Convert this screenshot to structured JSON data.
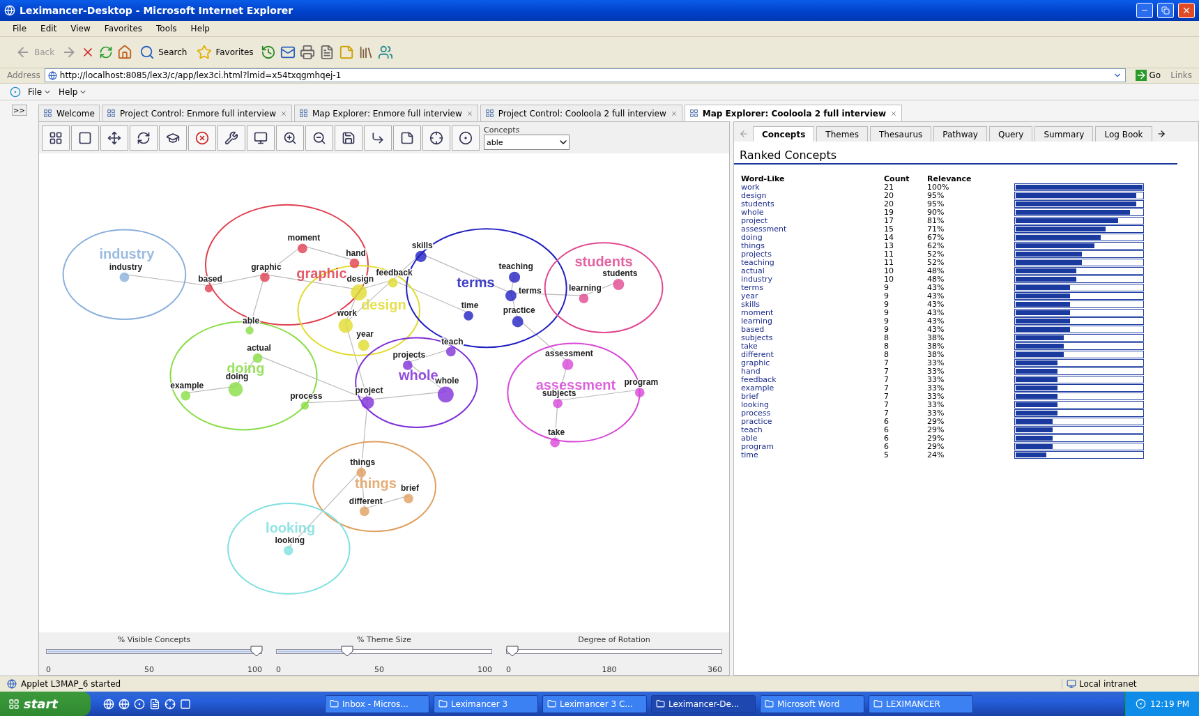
{
  "window": {
    "title": "Leximancer-Desktop - Microsoft Internet Explorer"
  },
  "menu_bar": [
    "File",
    "Edit",
    "View",
    "Favorites",
    "Tools",
    "Help"
  ],
  "toolbar_buttons": [
    {
      "label": "Back",
      "disabled": true
    },
    {
      "label": "Search",
      "disabled": false
    },
    {
      "label": "Favorites",
      "disabled": false
    }
  ],
  "address_bar": {
    "label": "Address",
    "value": "http://localhost:8085/lex3/c/app/lex3ci.html?lmid=x54txqgmhqej-1",
    "go": "Go",
    "links": "Links"
  },
  "app_menu": [
    "File",
    "Help"
  ],
  "side_toggle": ">>",
  "document_tabs": [
    {
      "label": "Welcome",
      "selected": false
    },
    {
      "label": "Project Control: Enmore full interview",
      "selected": false
    },
    {
      "label": "Map Explorer: Enmore full interview",
      "selected": false
    },
    {
      "label": "Project Control: Cooloola 2 full interview",
      "selected": false
    },
    {
      "label": "Map Explorer: Cooloola 2 full interview",
      "selected": true
    }
  ],
  "map_toolbar": {
    "concepts_label": "Concepts",
    "concepts_value": "able"
  },
  "themes": [
    {
      "name": "industry",
      "color": "#8ab0dc",
      "children": [
        {
          "name": "industry"
        }
      ]
    },
    {
      "name": "graphic",
      "color": "#e04050",
      "children": [
        {
          "name": "based"
        },
        {
          "name": "graphic"
        },
        {
          "name": "moment"
        },
        {
          "name": "hand"
        }
      ]
    },
    {
      "name": "design",
      "color": "#e0dc30",
      "children": [
        {
          "name": "design"
        },
        {
          "name": "work"
        },
        {
          "name": "year"
        },
        {
          "name": "feedback"
        }
      ]
    },
    {
      "name": "terms",
      "color": "#2020c0",
      "children": [
        {
          "name": "skills"
        },
        {
          "name": "teaching"
        },
        {
          "name": "terms"
        },
        {
          "name": "time"
        },
        {
          "name": "practice"
        }
      ]
    },
    {
      "name": "students",
      "color": "#e04890",
      "children": [
        {
          "name": "students"
        },
        {
          "name": "learning"
        }
      ]
    },
    {
      "name": "doing",
      "color": "#88dd44",
      "children": [
        {
          "name": "able"
        },
        {
          "name": "actual"
        },
        {
          "name": "doing"
        },
        {
          "name": "example"
        },
        {
          "name": "process"
        }
      ]
    },
    {
      "name": "whole",
      "color": "#8030d8",
      "children": [
        {
          "name": "project"
        },
        {
          "name": "projects"
        },
        {
          "name": "teach"
        },
        {
          "name": "whole"
        }
      ]
    },
    {
      "name": "assessment",
      "color": "#d848d8",
      "children": [
        {
          "name": "assessment"
        },
        {
          "name": "subjects"
        },
        {
          "name": "program"
        },
        {
          "name": "take"
        }
      ]
    },
    {
      "name": "things",
      "color": "#e0a060",
      "children": [
        {
          "name": "things"
        },
        {
          "name": "brief"
        },
        {
          "name": "different"
        }
      ]
    },
    {
      "name": "looking",
      "color": "#80e0e0",
      "children": [
        {
          "name": "looking"
        }
      ]
    }
  ],
  "sliders": [
    {
      "label": "% Visible Concepts",
      "level": 0.975,
      "ticks": [
        "0",
        "50",
        "100"
      ]
    },
    {
      "label": "% Theme Size",
      "level": 0.33,
      "ticks": [
        "0",
        "50",
        "100"
      ]
    },
    {
      "label": "Degree of Rotation",
      "level": 0.03,
      "ticks": [
        "0",
        "180",
        "360"
      ]
    }
  ],
  "panel_tabs": [
    {
      "label": "Concepts",
      "selected": true
    },
    {
      "label": "Themes",
      "selected": false
    },
    {
      "label": "Thesaurus",
      "selected": false
    },
    {
      "label": "Pathway",
      "selected": false
    },
    {
      "label": "Query",
      "selected": false
    },
    {
      "label": "Summary",
      "selected": false
    },
    {
      "label": "Log Book",
      "selected": false
    }
  ],
  "ranked": {
    "title": "Ranked Concepts",
    "columns": [
      "Word-Like",
      "Count",
      "Relevance"
    ],
    "rows": [
      {
        "word": "work",
        "count": "21",
        "relevance": "100%",
        "level": 1
      },
      {
        "word": "design",
        "count": "20",
        "relevance": "95%",
        "level": 0.95
      },
      {
        "word": "students",
        "count": "20",
        "relevance": "95%",
        "level": 0.95
      },
      {
        "word": "whole",
        "count": "19",
        "relevance": "90%",
        "level": 0.9
      },
      {
        "word": "project",
        "count": "17",
        "relevance": "81%",
        "level": 0.81
      },
      {
        "word": "assessment",
        "count": "15",
        "relevance": "71%",
        "level": 0.71
      },
      {
        "word": "doing",
        "count": "14",
        "relevance": "67%",
        "level": 0.67
      },
      {
        "word": "things",
        "count": "13",
        "relevance": "62%",
        "level": 0.62
      },
      {
        "word": "projects",
        "count": "11",
        "relevance": "52%",
        "level": 0.52
      },
      {
        "word": "teaching",
        "count": "11",
        "relevance": "52%",
        "level": 0.52
      },
      {
        "word": "actual",
        "count": "10",
        "relevance": "48%",
        "level": 0.48
      },
      {
        "word": "industry",
        "count": "10",
        "relevance": "48%",
        "level": 0.48
      },
      {
        "word": "terms",
        "count": "9",
        "relevance": "43%",
        "level": 0.43
      },
      {
        "word": "year",
        "count": "9",
        "relevance": "43%",
        "level": 0.43
      },
      {
        "word": "skills",
        "count": "9",
        "relevance": "43%",
        "level": 0.43
      },
      {
        "word": "moment",
        "count": "9",
        "relevance": "43%",
        "level": 0.43
      },
      {
        "word": "learning",
        "count": "9",
        "relevance": "43%",
        "level": 0.43
      },
      {
        "word": "based",
        "count": "9",
        "relevance": "43%",
        "level": 0.43
      },
      {
        "word": "subjects",
        "count": "8",
        "relevance": "38%",
        "level": 0.38
      },
      {
        "word": "take",
        "count": "8",
        "relevance": "38%",
        "level": 0.38
      },
      {
        "word": "different",
        "count": "8",
        "relevance": "38%",
        "level": 0.38
      },
      {
        "word": "graphic",
        "count": "7",
        "relevance": "33%",
        "level": 0.33
      },
      {
        "word": "hand",
        "count": "7",
        "relevance": "33%",
        "level": 0.33
      },
      {
        "word": "feedback",
        "count": "7",
        "relevance": "33%",
        "level": 0.33
      },
      {
        "word": "example",
        "count": "7",
        "relevance": "33%",
        "level": 0.33
      },
      {
        "word": "brief",
        "count": "7",
        "relevance": "33%",
        "level": 0.33
      },
      {
        "word": "looking",
        "count": "7",
        "relevance": "33%",
        "level": 0.33
      },
      {
        "word": "process",
        "count": "7",
        "relevance": "33%",
        "level": 0.33
      },
      {
        "word": "practice",
        "count": "6",
        "relevance": "29%",
        "level": 0.29
      },
      {
        "word": "teach",
        "count": "6",
        "relevance": "29%",
        "level": 0.29
      },
      {
        "word": "able",
        "count": "6",
        "relevance": "29%",
        "level": 0.29
      },
      {
        "word": "program",
        "count": "6",
        "relevance": "29%",
        "level": 0.29
      },
      {
        "word": "time",
        "count": "5",
        "relevance": "24%",
        "level": 0.24
      }
    ]
  },
  "status_bar": {
    "message": "Applet L3MAP_6 started",
    "zone": "Local intranet"
  },
  "taskbar": {
    "start": "start",
    "tasks": [
      {
        "label": "Inbox - Micros...",
        "selected": false
      },
      {
        "label": "Leximancer 3",
        "selected": false
      },
      {
        "label": "Leximancer 3 C...",
        "selected": false
      },
      {
        "label": "Leximancer-De...",
        "selected": true
      },
      {
        "label": "Microsoft Word",
        "selected": false
      },
      {
        "label": "LEXIMANCER",
        "selected": false
      }
    ],
    "clock": "12:19 PM"
  }
}
